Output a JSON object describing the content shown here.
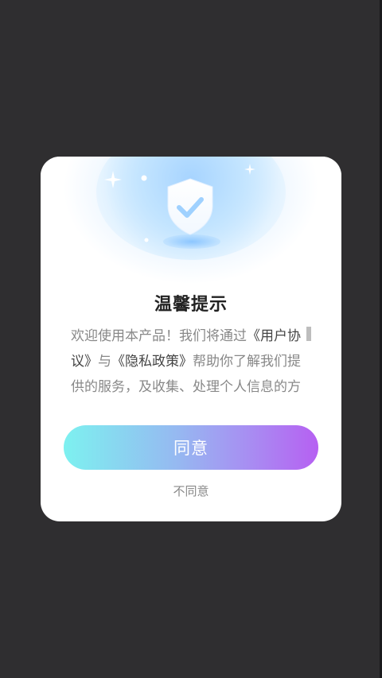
{
  "dialog": {
    "title": "温馨提示",
    "body": {
      "prefix": "欢迎使用本产品！我们将通过",
      "user_agreement_link": "《用户协议》",
      "connector": "与",
      "privacy_policy_link": "《隐私政策》",
      "suffix": "帮助你了解我们提供的服务，及收集、处理个人信息的方式。"
    },
    "agree_label": "同意",
    "disagree_label": "不同意",
    "shield_icon": "shield-check-icon"
  },
  "colors": {
    "agree_gradient_start": "#7df1f0",
    "agree_gradient_end": "#b660f2",
    "overlay": "#2f2e30"
  }
}
